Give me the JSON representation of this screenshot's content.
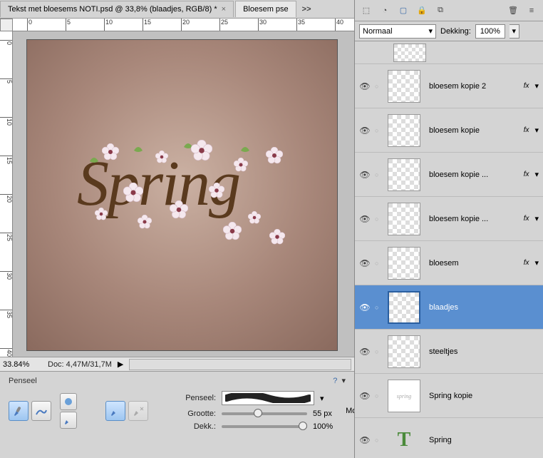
{
  "tabs": [
    {
      "label": "Tekst met bloesems NOTI.psd @ 33,8% (blaadjes, RGB/8) *",
      "active": true
    },
    {
      "label": "Bloesem pse",
      "active": false
    }
  ],
  "tabs_overflow": ">>",
  "ruler_h": [
    "0",
    "5",
    "10",
    "15",
    "20",
    "25",
    "30",
    "35",
    "40"
  ],
  "ruler_v": [
    "0",
    "5",
    "10",
    "15",
    "20",
    "25",
    "30",
    "35",
    "40"
  ],
  "canvas": {
    "text": "Spring"
  },
  "status": {
    "zoom": "33.84%",
    "doc": "Doc: 4,47M/31,7M",
    "arrow": "▶"
  },
  "options": {
    "title": "Penseel",
    "help": "?",
    "menu": "▾",
    "brush_label": "Penseel:",
    "size_label": "Grootte:",
    "size_value": "55 px",
    "opacity_label": "Dekk.:",
    "opacity_value": "100%",
    "mode_label": "Modu:"
  },
  "panel_icons": [
    "⬚",
    "◔",
    "▢",
    "🔒",
    "⧉",
    "🗑",
    "≡"
  ],
  "blend": {
    "mode": "Normaal",
    "opacity_label": "Dekking:",
    "opacity": "100%"
  },
  "layers": [
    {
      "name": "bloesem kopie 2",
      "fx": "fx",
      "type": "raster"
    },
    {
      "name": "bloesem kopie",
      "fx": "fx",
      "type": "raster"
    },
    {
      "name": "bloesem kopie ...",
      "fx": "fx",
      "type": "raster"
    },
    {
      "name": "bloesem kopie ...",
      "fx": "fx",
      "type": "raster"
    },
    {
      "name": "bloesem",
      "fx": "fx",
      "type": "raster"
    },
    {
      "name": "blaadjes",
      "fx": "",
      "type": "raster",
      "selected": true
    },
    {
      "name": "steeltjes",
      "fx": "",
      "type": "raster"
    },
    {
      "name": "Spring kopie",
      "fx": "",
      "type": "smart"
    },
    {
      "name": "Spring",
      "fx": "",
      "type": "text"
    }
  ]
}
